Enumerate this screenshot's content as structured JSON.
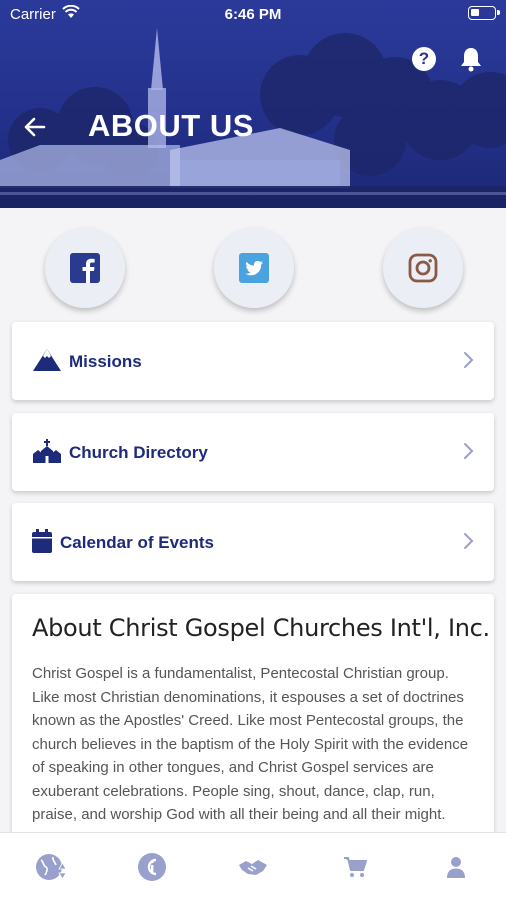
{
  "status_bar": {
    "carrier": "Carrier",
    "time": "6:46 PM"
  },
  "header": {
    "title": "ABOUT US"
  },
  "social": [
    {
      "name": "facebook",
      "icon": "facebook-icon",
      "color": "#2a3b8f"
    },
    {
      "name": "twitter",
      "icon": "twitter-icon",
      "color": "#4aa3df"
    },
    {
      "name": "instagram",
      "icon": "instagram-icon",
      "color": "#8b5a44"
    }
  ],
  "menu": [
    {
      "label": "Missions",
      "icon": "mountain-icon"
    },
    {
      "label": "Church Directory",
      "icon": "church-icon"
    },
    {
      "label": "Calendar of Events",
      "icon": "calendar-icon"
    }
  ],
  "about": {
    "title": "About Christ Gospel Churches Int'l, Inc.",
    "body": "Christ Gospel is a fundamentalist, Pentecostal Christian group. Like most Christian denominations, it espouses a set of doctrines known as the Apostles' Creed. Like most Pentecostal groups, the church believes in the baptism of the Holy Spirit with the evidence of speaking in other tongues, and Christ Gospel services are exuberant celebrations. People sing, shout, dance, clap, run, praise, and worship God with all their being and all their might."
  },
  "bottom_nav": [
    {
      "name": "globe",
      "icon": "globe-icon"
    },
    {
      "name": "info",
      "icon": "info-icon"
    },
    {
      "name": "handshake",
      "icon": "handshake-icon"
    },
    {
      "name": "cart",
      "icon": "cart-icon"
    },
    {
      "name": "profile",
      "icon": "user-icon"
    }
  ],
  "colors": {
    "brand": "#27348f",
    "nav_icon": "#9aa0cc",
    "chevron": "#9aa0cc"
  }
}
